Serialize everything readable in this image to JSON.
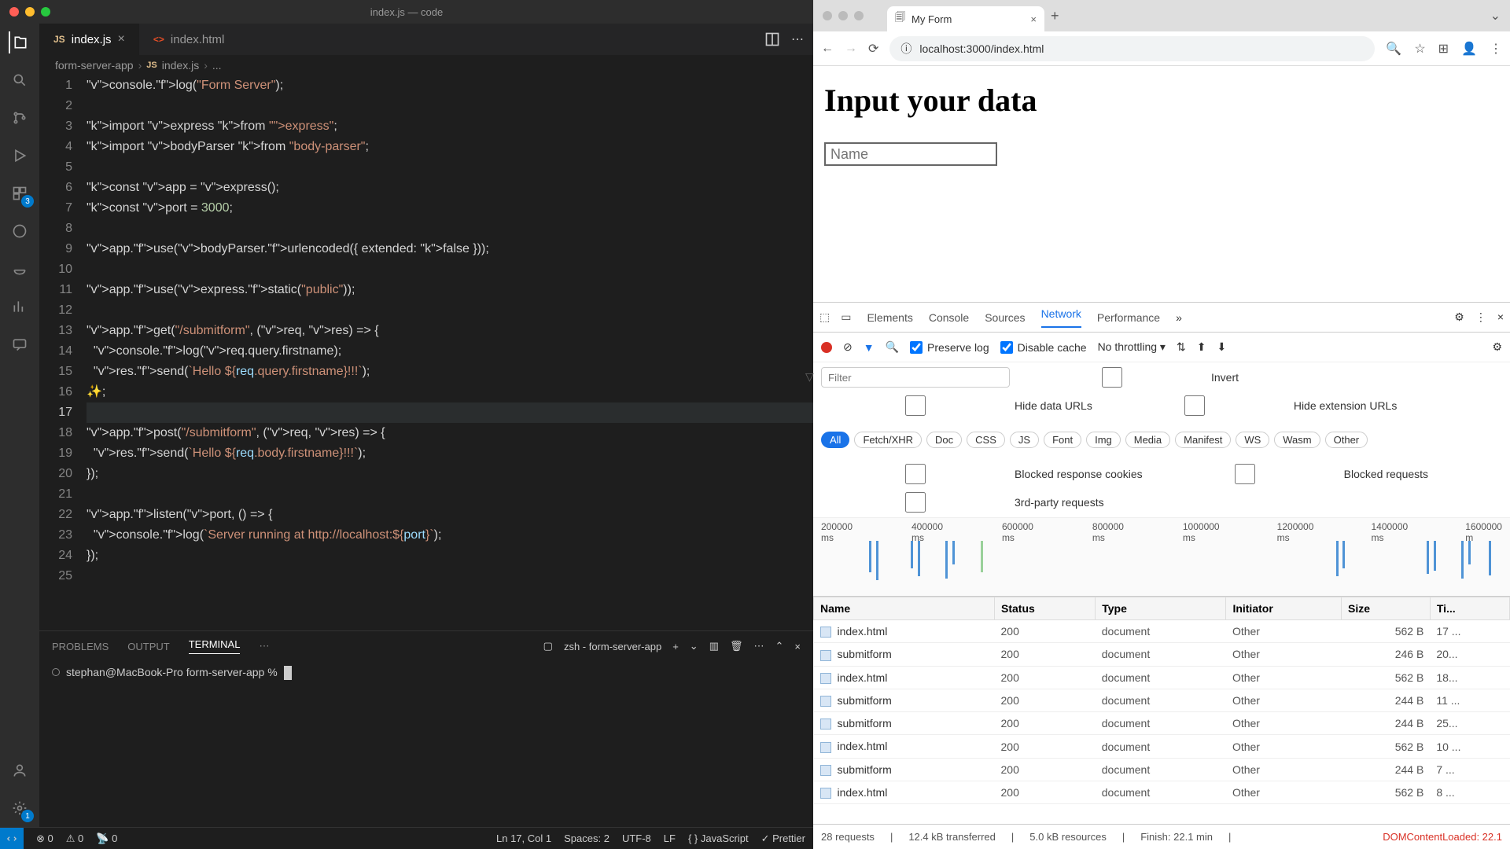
{
  "vscode": {
    "window_title": "index.js — code",
    "tabs": [
      {
        "icon": "JS",
        "label": "index.js",
        "active": true
      },
      {
        "icon": "<>",
        "label": "index.html",
        "active": false
      }
    ],
    "breadcrumb": {
      "folder": "form-server-app",
      "file": "index.js",
      "more": "..."
    },
    "code_lines": [
      "console.log(\"Form Server\");",
      "",
      "import express from \"express\";",
      "import bodyParser from \"body-parser\";",
      "",
      "const app = express();",
      "const port = 3000;",
      "",
      "app.use(bodyParser.urlencoded({ extended: false }));",
      "",
      "app.use(express.static(\"public\"));",
      "",
      "app.get(\"/submitform\", (req, res) => {",
      "  console.log(req.query.firstname);",
      "  res.send(`Hello ${req.query.firstname}!!!`);",
      "});",
      "",
      "app.post(\"/submitform\", (req, res) => {",
      "  res.send(`Hello ${req.body.firstname}!!!`);",
      "});",
      "",
      "app.listen(port, () => {",
      "  console.log(`Server running at http://localhost:${port}`);",
      "});",
      ""
    ],
    "panel": {
      "tabs": [
        "PROBLEMS",
        "OUTPUT",
        "TERMINAL"
      ],
      "active": "TERMINAL",
      "shell_label": "zsh - form-server-app",
      "prompt": "stephan@MacBook-Pro form-server-app %"
    },
    "status": {
      "errors": "0",
      "warnings": "0",
      "ports": "0",
      "ln": "Ln 17, Col 1",
      "spaces": "Spaces: 2",
      "enc": "UTF-8",
      "eol": "LF",
      "lang": "JavaScript",
      "prettier": "Prettier"
    },
    "ext_badge": "3"
  },
  "browser": {
    "tab_title": "My Form",
    "url": "localhost:3000/index.html",
    "page_heading": "Input your data",
    "input_placeholder": "Name"
  },
  "devtools": {
    "tabs": [
      "Elements",
      "Console",
      "Sources",
      "Network",
      "Performance"
    ],
    "toolbar": {
      "preserve": "Preserve log",
      "disable": "Disable cache",
      "throttle": "No throttling"
    },
    "filter": {
      "placeholder": "Filter",
      "invert": "Invert",
      "hide_urls": "Hide data URLs",
      "hide_ext": "Hide extension URLs",
      "pills": [
        "All",
        "Fetch/XHR",
        "Doc",
        "CSS",
        "JS",
        "Font",
        "Img",
        "Media",
        "Manifest",
        "WS",
        "Wasm",
        "Other"
      ],
      "blocked_cookies": "Blocked response cookies",
      "blocked_req": "Blocked requests",
      "third": "3rd-party requests"
    },
    "timeline_ticks": [
      "200000 ms",
      "400000 ms",
      "600000 ms",
      "800000 ms",
      "1000000 ms",
      "1200000 ms",
      "1400000 ms",
      "1600000 m"
    ],
    "columns": [
      "Name",
      "Status",
      "Type",
      "Initiator",
      "Size",
      "Ti..."
    ],
    "rows": [
      {
        "name": "index.html",
        "status": "200",
        "type": "document",
        "initiator": "Other",
        "size": "562 B",
        "time": "17 ..."
      },
      {
        "name": "submitform",
        "status": "200",
        "type": "document",
        "initiator": "Other",
        "size": "246 B",
        "time": "20..."
      },
      {
        "name": "index.html",
        "status": "200",
        "type": "document",
        "initiator": "Other",
        "size": "562 B",
        "time": "18..."
      },
      {
        "name": "submitform",
        "status": "200",
        "type": "document",
        "initiator": "Other",
        "size": "244 B",
        "time": "11 ..."
      },
      {
        "name": "submitform",
        "status": "200",
        "type": "document",
        "initiator": "Other",
        "size": "244 B",
        "time": "25..."
      },
      {
        "name": "index.html",
        "status": "200",
        "type": "document",
        "initiator": "Other",
        "size": "562 B",
        "time": "10 ..."
      },
      {
        "name": "submitform",
        "status": "200",
        "type": "document",
        "initiator": "Other",
        "size": "244 B",
        "time": "7 ..."
      },
      {
        "name": "index.html",
        "status": "200",
        "type": "document",
        "initiator": "Other",
        "size": "562 B",
        "time": "8 ..."
      }
    ],
    "status": {
      "requests": "28 requests",
      "transferred": "12.4 kB transferred",
      "resources": "5.0 kB resources",
      "finish": "Finish: 22.1 min",
      "dom": "DOMContentLoaded: 22.1"
    }
  }
}
